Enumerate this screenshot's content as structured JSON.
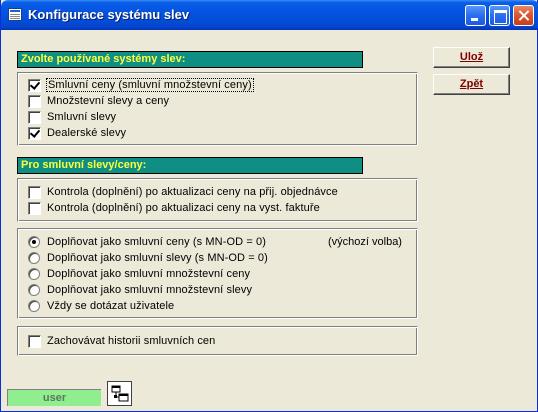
{
  "window": {
    "title": "Konfigurace systému slev",
    "colors": {
      "title_bar": "#0553e0",
      "header_bg": "#0f8f84",
      "header_text": "#ffff40",
      "button_text": "#800000",
      "status_bg": "#90ee90"
    }
  },
  "buttons": {
    "save": "Ulož",
    "back": "Zpět"
  },
  "systems": {
    "header": "Zvolte používané systémy slev:",
    "items": [
      {
        "label": "Smluvní ceny (smluvní množstevní ceny)",
        "checked": true
      },
      {
        "label": "Množstevní slevy a ceny",
        "checked": false
      },
      {
        "label": "Smluvní slevy",
        "checked": false
      },
      {
        "label": "Dealerské slevy",
        "checked": true
      }
    ]
  },
  "contract": {
    "header": "Pro smluvní slevy/ceny:",
    "checks": [
      {
        "label": "Kontrola (doplnění) po aktualizaci ceny na přij. objednávce",
        "checked": false
      },
      {
        "label": "Kontrola (doplnění) po aktualizaci ceny na vyst. faktuře",
        "checked": false
      }
    ],
    "options": [
      {
        "label": "Doplňovat jako smluvní ceny (s MN-OD = 0)",
        "note": "(výchozí volba)",
        "selected": true
      },
      {
        "label": "Doplňovat jako smluvní slevy (s MN-OD = 0)",
        "selected": false
      },
      {
        "label": "Doplňovat jako smluvní množstevní ceny",
        "selected": false
      },
      {
        "label": "Doplňovat jako smluvní množstevní slevy",
        "selected": false
      },
      {
        "label": "Vždy se dotázat uživatele",
        "selected": false
      }
    ],
    "history": {
      "label": "Zachovávat historii smluvních cen",
      "checked": false
    }
  },
  "status": {
    "user": "user",
    "tool_icon": "relationships-icon"
  }
}
